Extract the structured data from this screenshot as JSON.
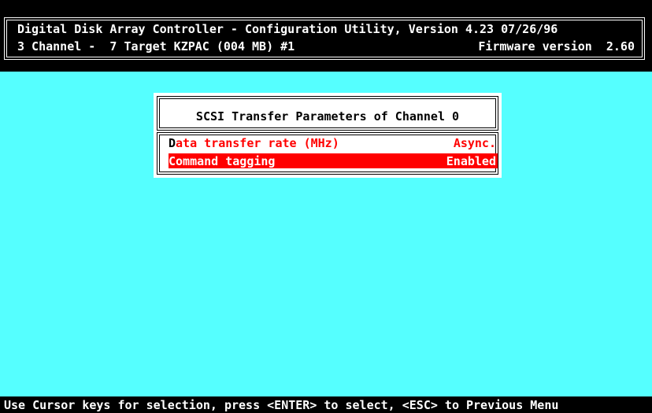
{
  "header": {
    "line1": "Digital Disk Array Controller - Configuration Utility, Version 4.23 07/26/96",
    "line2": "3 Channel -  7 Target KZPAC (004 MB) #1",
    "firmware": "Firmware version  2.60"
  },
  "dialog": {
    "title": "SCSI Transfer Parameters of Channel 0",
    "items": [
      {
        "hotkey": "D",
        "label": "ata transfer rate (MHz)",
        "value": "Async."
      },
      {
        "hotkey": "C",
        "label": "ommand tagging",
        "value": "Enabled"
      }
    ]
  },
  "statusbar": {
    "text": "Use Cursor keys for selection, press <ENTER> to select, <ESC> to Previous Menu"
  },
  "colors": {
    "background": "#55ffff",
    "highlight": "#ff0000",
    "screen": "#000000"
  }
}
